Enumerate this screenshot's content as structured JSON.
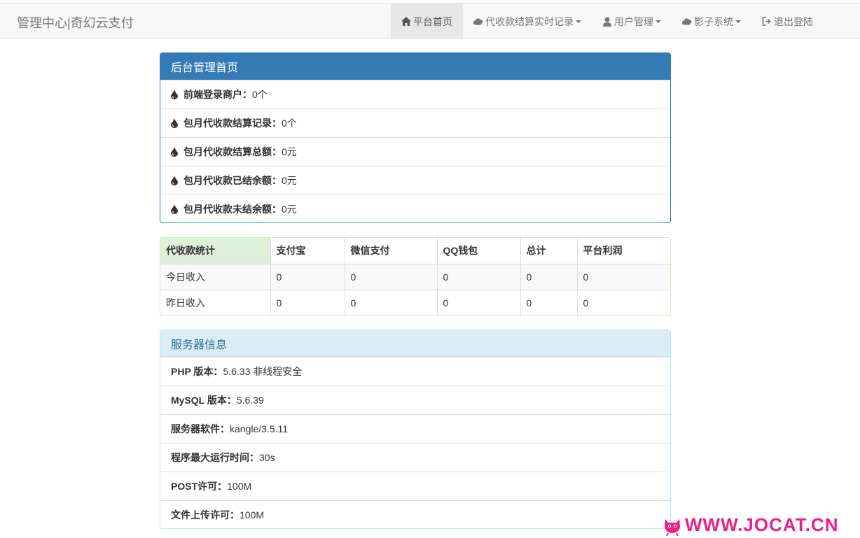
{
  "navbar": {
    "brand": "管理中心|奇幻云支付",
    "items": [
      {
        "label": "平台首页",
        "icon": "home-icon"
      },
      {
        "label": "代收款结算实时记录",
        "icon": "cloud-icon"
      },
      {
        "label": "用户管理",
        "icon": "user-icon"
      },
      {
        "label": "影子系统",
        "icon": "cloud-icon"
      },
      {
        "label": "退出登陆",
        "icon": "logout-icon"
      }
    ]
  },
  "overview": {
    "title": "后台管理首页",
    "rows": [
      {
        "label": "前端登录商户：",
        "value": "0个"
      },
      {
        "label": "包月代收款结算记录：",
        "value": "0个"
      },
      {
        "label": "包月代收款结算总额：",
        "value": "0元"
      },
      {
        "label": "包月代收款已结余额：",
        "value": "0元"
      },
      {
        "label": "包月代收款未结余额：",
        "value": "0元"
      }
    ]
  },
  "stats": {
    "headers": [
      "代收款统计",
      "支付宝",
      "微信支付",
      "QQ钱包",
      "总计",
      "平台利润"
    ],
    "rows": [
      [
        "今日收入",
        "0",
        "0",
        "0",
        "0",
        "0"
      ],
      [
        "昨日收入",
        "0",
        "0",
        "0",
        "0",
        "0"
      ]
    ]
  },
  "server": {
    "title": "服务器信息",
    "rows": [
      {
        "label": "PHP 版本：",
        "value": "5.6.33 非线程安全"
      },
      {
        "label": "MySQL 版本：",
        "value": "5.6.39"
      },
      {
        "label": "服务器软件：",
        "value": "kangle/3.5.11"
      },
      {
        "label": "程序最大运行时间：",
        "value": "30s"
      },
      {
        "label": "POST许可：",
        "value": "100M"
      },
      {
        "label": "文件上传许可：",
        "value": "100M"
      }
    ]
  },
  "watermark": {
    "text": "WWW.JOCAT.CN"
  },
  "colors": {
    "primary": "#337ab7",
    "info_bg": "#d9edf7",
    "success_bg": "#dff0d8",
    "watermark": "#e8208c"
  }
}
